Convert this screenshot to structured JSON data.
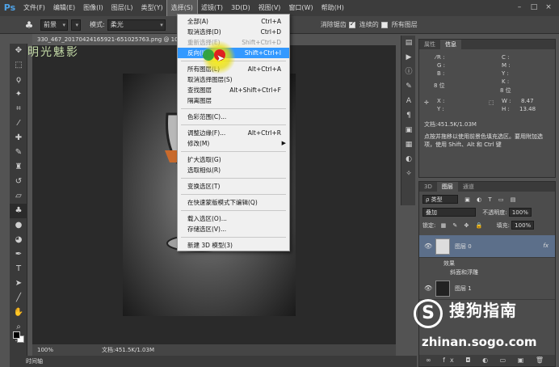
{
  "menubar": {
    "logo": "Ps",
    "items": [
      "文件(F)",
      "编辑(E)",
      "图像(I)",
      "图层(L)",
      "类型(Y)",
      "选择(S)",
      "滤镜(T)",
      "3D(D)",
      "视图(V)",
      "窗口(W)",
      "帮助(H)"
    ],
    "active_index": 5,
    "window_controls": [
      "–",
      "□",
      "×"
    ]
  },
  "options": {
    "preset_value": "前景",
    "mode_label": "模式:",
    "mode_value": "柔光",
    "anti_alias_label": "消除锯齿",
    "contiguous_label": "连续的",
    "all_layers_label": "所有图层"
  },
  "document": {
    "tab_title": "330_467_20170424165921-651025763.png @ 10",
    "zoom": "100%",
    "doc_info": "文档:451.5K/1.03M",
    "top_watermark": "明光魅影"
  },
  "timeline_label": "时间轴",
  "select_menu": {
    "items": [
      {
        "label": "全部(A)",
        "shortcut": "Ctrl+A"
      },
      {
        "label": "取消选择(D)",
        "shortcut": "Ctrl+D"
      },
      {
        "label": "重新选择(E)",
        "shortcut": "Shift+Ctrl+D",
        "disabled": true
      },
      {
        "label": "反向(I)",
        "shortcut": "Shift+Ctrl+I",
        "highlight": true
      },
      {
        "sep": true
      },
      {
        "label": "所有图层(L)",
        "shortcut": "Alt+Ctrl+A"
      },
      {
        "label": "取消选择图层(S)",
        "shortcut": ""
      },
      {
        "label": "查找图层",
        "shortcut": "Alt+Shift+Ctrl+F"
      },
      {
        "label": "隔离图层",
        "shortcut": ""
      },
      {
        "sep": true
      },
      {
        "label": "色彩范围(C)...",
        "shortcut": ""
      },
      {
        "sep": true
      },
      {
        "label": "调整边缘(F)...",
        "shortcut": "Alt+Ctrl+R"
      },
      {
        "label": "修改(M)",
        "shortcut": "",
        "submenu": true
      },
      {
        "sep": true
      },
      {
        "label": "扩大选取(G)",
        "shortcut": ""
      },
      {
        "label": "选取相似(R)",
        "shortcut": ""
      },
      {
        "sep": true
      },
      {
        "label": "变换选区(T)",
        "shortcut": ""
      },
      {
        "sep": true
      },
      {
        "label": "在快速蒙版模式下编辑(Q)",
        "shortcut": ""
      },
      {
        "sep": true
      },
      {
        "label": "载入选区(O)...",
        "shortcut": ""
      },
      {
        "label": "存储选区(V)...",
        "shortcut": ""
      },
      {
        "sep": true
      },
      {
        "label": "新建 3D 模型(3)",
        "shortcut": ""
      }
    ]
  },
  "info_panel": {
    "tabs": [
      "属性",
      "信息"
    ],
    "rgb": [
      "R :",
      "G :",
      "B :"
    ],
    "cmyk": [
      "C :",
      "M :",
      "Y :",
      "K :"
    ],
    "bit_left": "8 位",
    "bit_right": "8 位",
    "xy": [
      "X :",
      "Y :"
    ],
    "wh": [
      "W :",
      "H :"
    ],
    "w_value": "8.47",
    "h_value": "13.48",
    "doc": "文档:451.5K/1.03M",
    "hint": "点按并拖移以使用前景色填充选区。要用附加选项，使用 Shift、Alt 和 Ctrl 键"
  },
  "layers_panel": {
    "tabs": [
      "3D",
      "图层",
      "通道"
    ],
    "filter": "类型",
    "blend": "叠加",
    "opacity_label": "不透明度:",
    "opacity": "100%",
    "lock_label": "锁定:",
    "fill_label": "填充:",
    "fill": "100%",
    "layers": [
      {
        "name": "图层 0",
        "fx": "fx",
        "selected": true
      },
      {
        "name": "图层 1",
        "fx": "",
        "selected": false
      }
    ],
    "effects_label": "效果",
    "effect_name": "斜面和浮雕",
    "bottom_icons": "∞ fx ◘ ◐ ▭ ▣ 🗑"
  },
  "sogou": {
    "text": "搜狗指南",
    "url": "zhinan.sogo.com",
    "logo": "S"
  },
  "colors": {
    "menu_highlight": "#3399ff",
    "app_bg": "#535353"
  }
}
